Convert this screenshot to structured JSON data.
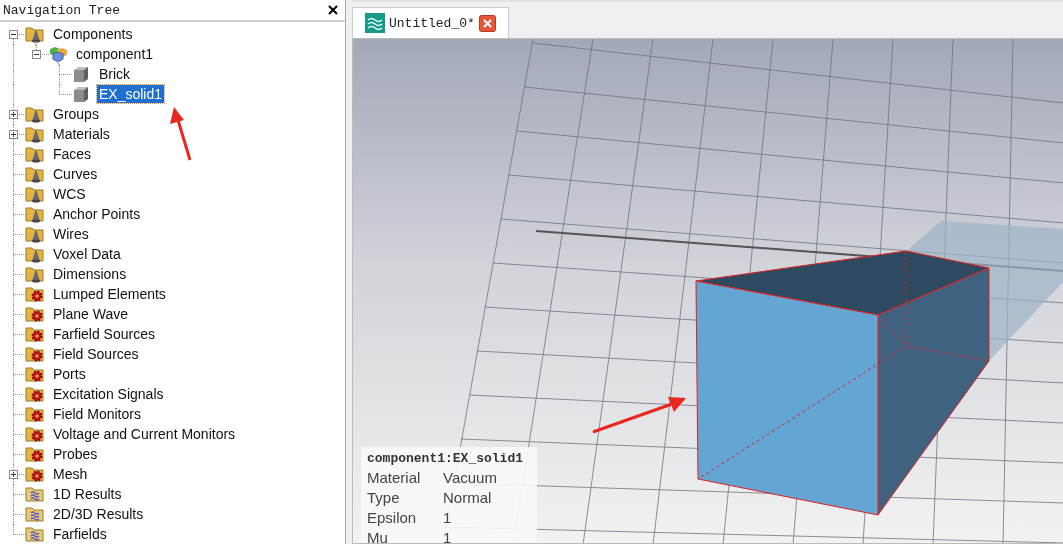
{
  "navigation_tree": {
    "title": "Navigation Tree",
    "items": [
      {
        "label": "Components",
        "kind": "folder-cone",
        "has_children": true,
        "expanded": true,
        "selected": false,
        "children": [
          {
            "label": "component1",
            "kind": "component",
            "has_children": true,
            "expanded": true,
            "selected": false,
            "children": [
              {
                "label": "Brick",
                "kind": "solid",
                "has_children": false,
                "selected": false
              },
              {
                "label": "EX_solid1",
                "kind": "solid",
                "has_children": false,
                "selected": true
              }
            ]
          }
        ]
      },
      {
        "label": "Groups",
        "kind": "folder-cone",
        "has_children": true,
        "expanded": false,
        "selected": false
      },
      {
        "label": "Materials",
        "kind": "folder-cone",
        "has_children": true,
        "expanded": false,
        "selected": false
      },
      {
        "label": "Faces",
        "kind": "folder-cone",
        "has_children": false,
        "selected": false
      },
      {
        "label": "Curves",
        "kind": "folder-cone",
        "has_children": false,
        "selected": false
      },
      {
        "label": "WCS",
        "kind": "folder-cone",
        "has_children": false,
        "selected": false
      },
      {
        "label": "Anchor Points",
        "kind": "folder-cone",
        "has_children": false,
        "selected": false
      },
      {
        "label": "Wires",
        "kind": "folder-cone",
        "has_children": false,
        "selected": false
      },
      {
        "label": "Voxel Data",
        "kind": "folder-cone",
        "has_children": false,
        "selected": false
      },
      {
        "label": "Dimensions",
        "kind": "folder-cone",
        "has_children": false,
        "selected": false
      },
      {
        "label": "Lumped Elements",
        "kind": "folder-gear",
        "has_children": false,
        "selected": false
      },
      {
        "label": "Plane Wave",
        "kind": "folder-gear",
        "has_children": false,
        "selected": false
      },
      {
        "label": "Farfield Sources",
        "kind": "folder-gear",
        "has_children": false,
        "selected": false
      },
      {
        "label": "Field Sources",
        "kind": "folder-gear",
        "has_children": false,
        "selected": false
      },
      {
        "label": "Ports",
        "kind": "folder-gear",
        "has_children": false,
        "selected": false
      },
      {
        "label": "Excitation Signals",
        "kind": "folder-gear",
        "has_children": false,
        "selected": false
      },
      {
        "label": "Field Monitors",
        "kind": "folder-gear",
        "has_children": false,
        "selected": false
      },
      {
        "label": "Voltage and Current Monitors",
        "kind": "folder-gear",
        "has_children": false,
        "selected": false
      },
      {
        "label": "Probes",
        "kind": "folder-gear",
        "has_children": false,
        "selected": false
      },
      {
        "label": "Mesh",
        "kind": "folder-gear",
        "has_children": true,
        "expanded": false,
        "selected": false
      },
      {
        "label": "1D Results",
        "kind": "folder-wave",
        "has_children": false,
        "selected": false
      },
      {
        "label": "2D/3D Results",
        "kind": "folder-wave",
        "has_children": false,
        "selected": false
      },
      {
        "label": "Farfields",
        "kind": "folder-wave",
        "has_children": false,
        "selected": false
      }
    ]
  },
  "tabs": [
    {
      "label": "Untitled_0*",
      "selected": true
    }
  ],
  "info_panel": {
    "title": "component1:EX_solid1",
    "rows": [
      {
        "name": "Material",
        "value": "Vacuum"
      },
      {
        "name": "Type",
        "value": "Normal"
      },
      {
        "name": "Epsilon",
        "value": "1"
      },
      {
        "name": "Mu",
        "value": "1"
      }
    ]
  }
}
